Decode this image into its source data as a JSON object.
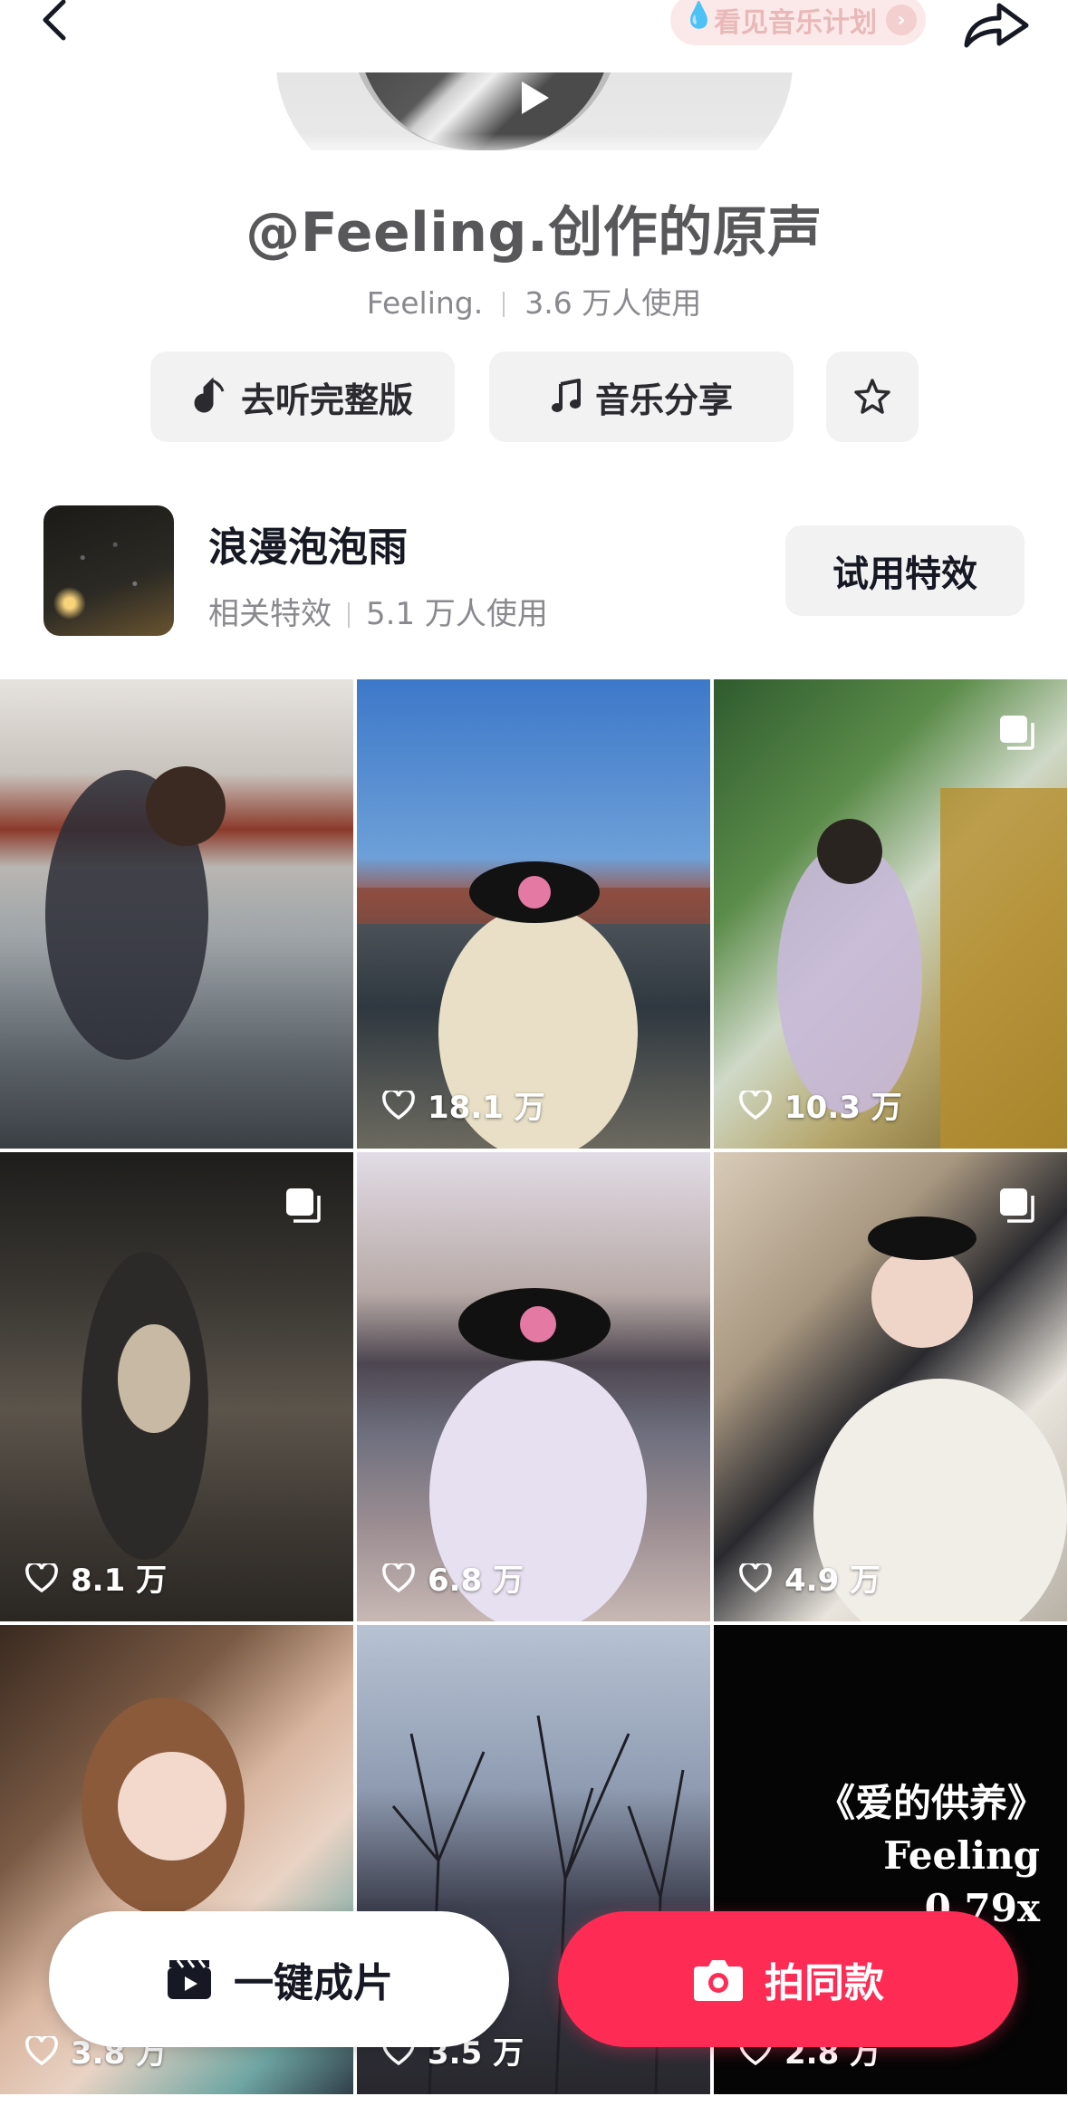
{
  "top_bar": {
    "plan_label": "看见音乐计划"
  },
  "sound": {
    "title": "@Feeling.创作的原声",
    "author": "Feeling.",
    "usage": "3.6 万人使用"
  },
  "actions": {
    "listen_full": "去听完整版",
    "music_share": "音乐分享"
  },
  "effect": {
    "name": "浪漫泡泡雨",
    "tag": "相关特效",
    "usage": "5.1 万人使用",
    "try_label": "试用特效"
  },
  "videos": [
    {
      "likes": "",
      "multi": false
    },
    {
      "likes": "18.1 万",
      "multi": false
    },
    {
      "likes": "10.3 万",
      "multi": true
    },
    {
      "likes": "8.1 万",
      "multi": true
    },
    {
      "likes": "6.8 万",
      "multi": false
    },
    {
      "likes": "4.9 万",
      "multi": true
    },
    {
      "likes": "3.8 万",
      "multi": false
    },
    {
      "likes": "3.5 万",
      "multi": false
    },
    {
      "likes": "2.8 万",
      "multi": false,
      "overlay_lines": [
        "《爱的供养》",
        "Feeling",
        "0.79x"
      ]
    }
  ],
  "bottom": {
    "one_tap_label": "一键成片",
    "shoot_same_label": "拍同款"
  },
  "colors": {
    "accent": "#fe2c55",
    "button_bg": "#f2f2f3",
    "muted_text": "#8a8a8e"
  }
}
